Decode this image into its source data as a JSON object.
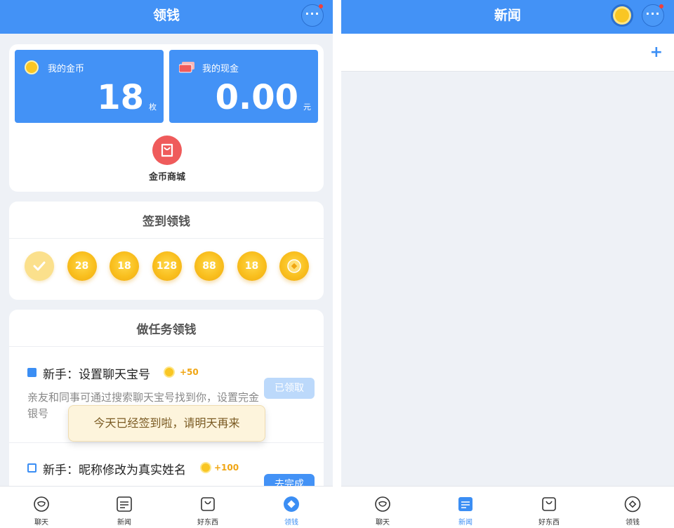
{
  "left_screen": {
    "header": {
      "title": "领钱"
    },
    "wallet": {
      "coins": {
        "label": "我的金币",
        "value": "18",
        "unit": "枚"
      },
      "cash": {
        "label": "我的现金",
        "value": "0.00",
        "unit": "元"
      },
      "shop": {
        "label": "金币商城"
      }
    },
    "checkin": {
      "title": "签到领钱",
      "days": [
        {
          "value": "",
          "state": "done"
        },
        {
          "value": "28",
          "state": "pending"
        },
        {
          "value": "18",
          "state": "pending"
        },
        {
          "value": "128",
          "state": "pending"
        },
        {
          "value": "88",
          "state": "pending"
        },
        {
          "value": "18",
          "state": "pending"
        },
        {
          "value": "",
          "state": "gift"
        }
      ]
    },
    "tasks": {
      "title": "做任务领钱",
      "items": [
        {
          "title": "新手：设置聊天宝号",
          "reward": "+50",
          "desc": "亲友和同事可通过搜索聊天宝号找到你，设置完金银号",
          "button": "已领取",
          "checked": true
        },
        {
          "title": "新手：昵称修改为真实姓名",
          "reward": "+100",
          "desc": "",
          "button": "去完成",
          "checked": false
        }
      ]
    },
    "toast": "今天已经签到啦，请明天再来"
  },
  "right_screen": {
    "header": {
      "title": "新闻"
    },
    "add_label": "+"
  },
  "tabbar": {
    "items": [
      {
        "label": "聊天",
        "icon": "chat-icon"
      },
      {
        "label": "新闻",
        "icon": "news-icon"
      },
      {
        "label": "好东西",
        "icon": "bag-icon"
      },
      {
        "label": "领钱",
        "icon": "coin-tab-icon"
      }
    ]
  },
  "colors": {
    "primary": "#4392f6",
    "coin": "#f9c623",
    "reward": "#f0a512",
    "shop": "#ef5b5b",
    "toast_bg": "#fdf4dc"
  }
}
